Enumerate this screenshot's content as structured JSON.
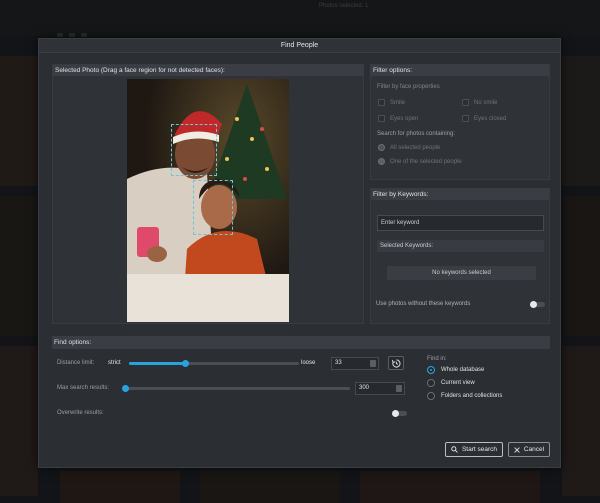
{
  "background": {
    "status_text": "Photos selected: 1"
  },
  "dialog": {
    "title": "Find People"
  },
  "photo_panel": {
    "header": "Selected Photo (Drag a face region for not detected faces):"
  },
  "filter_options": {
    "header": "Filter options:",
    "face_props_label": "Filter by face properties",
    "checkboxes": [
      {
        "label": "Smile",
        "checked": false
      },
      {
        "label": "No smile",
        "checked": false
      },
      {
        "label": "Eyes open",
        "checked": false
      },
      {
        "label": "Eyes closed",
        "checked": false
      }
    ],
    "contains_label": "Search for photos containing:",
    "radios": [
      {
        "label": "All selected people",
        "selected": true
      },
      {
        "label": "One of the selected people",
        "selected": false
      }
    ]
  },
  "keywords": {
    "header": "Filter by Keywords:",
    "input_placeholder": "Enter keyword",
    "selected_header": "Selected Keywords:",
    "empty_text": "No keywords selected",
    "exclude_label": "Use photos without these keywords",
    "exclude_on": false
  },
  "find_options": {
    "header": "Find options:",
    "distance": {
      "label": "Distance limit:",
      "min_label": "strict",
      "max_label": "loose",
      "value": "33",
      "fraction": 0.33
    },
    "max_results": {
      "label": "Max search results:",
      "value": "300",
      "fraction": 0.0
    },
    "overwrite": {
      "label": "Overwrite results:",
      "on": false
    },
    "find_in": {
      "label": "Find in:",
      "options": [
        {
          "label": "Whole database",
          "selected": true
        },
        {
          "label": "Current view",
          "selected": false
        },
        {
          "label": "Folders and collections",
          "selected": false
        }
      ]
    }
  },
  "buttons": {
    "start": "Start search",
    "cancel": "Cancel"
  },
  "colors": {
    "accent": "#29a3e0",
    "dialog_bg": "#2b2e33",
    "panel_header": "#3a3e44"
  }
}
